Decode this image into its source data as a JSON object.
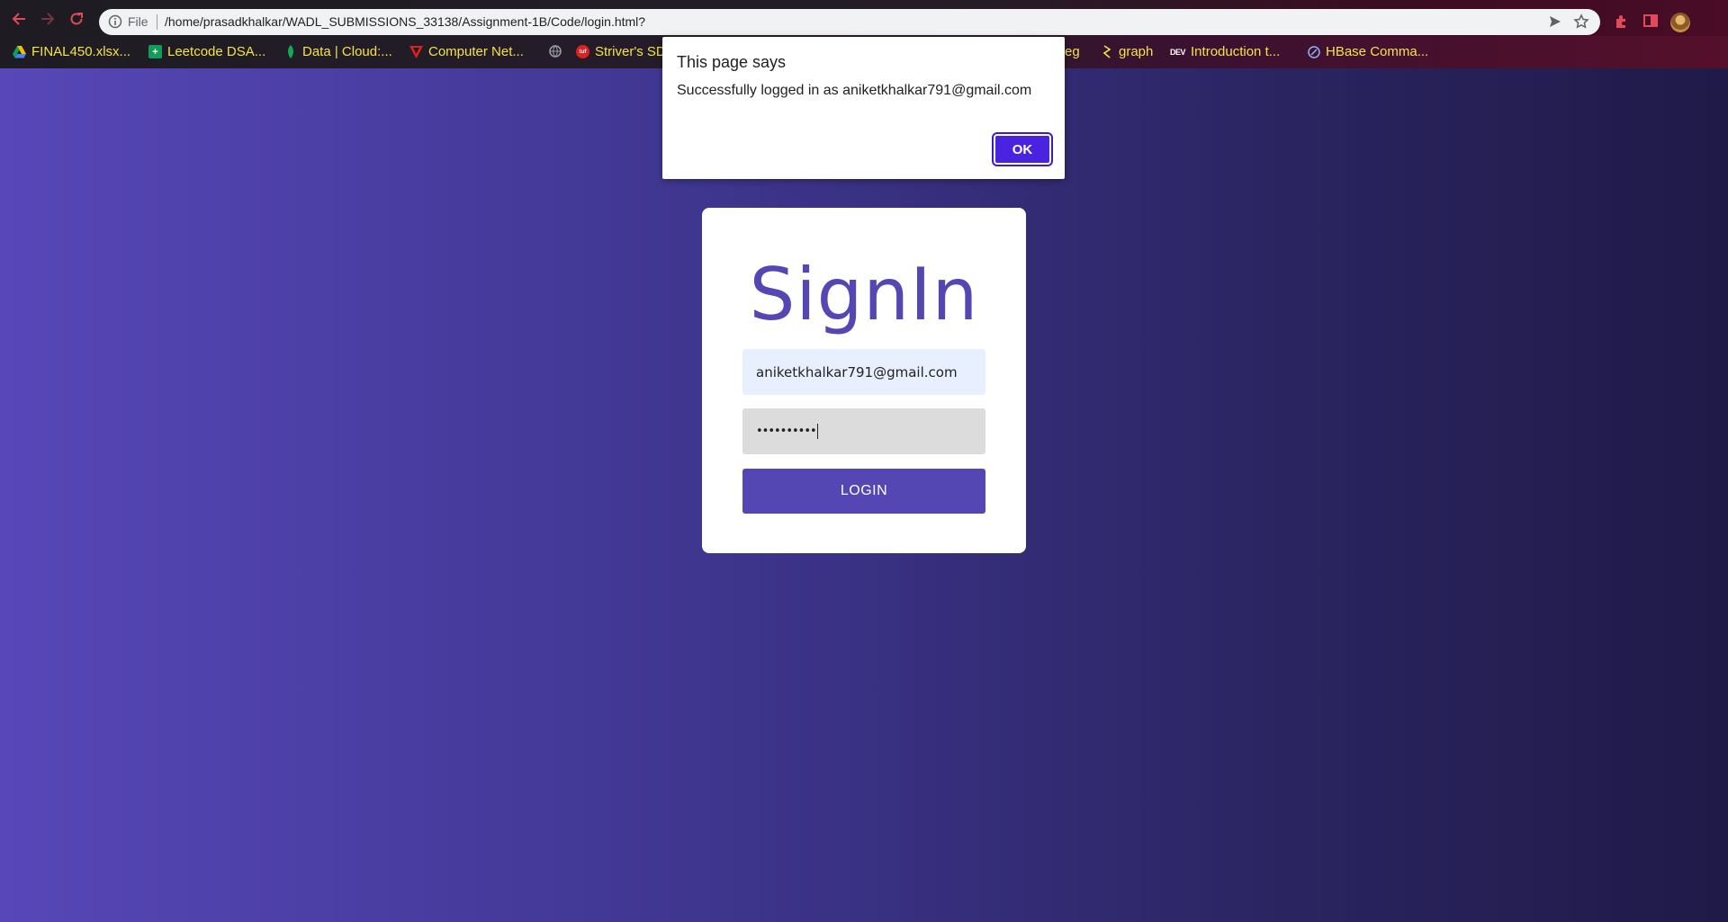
{
  "browser": {
    "url_scheme_label": "File",
    "url": "/home/prasadkhalkar/WADL_SUBMISSIONS_33138/Assignment-1B/Code/login.html?",
    "bookmarks": [
      {
        "label": "FINAL450.xlsx...",
        "icon": "google-drive-icon"
      },
      {
        "label": "Leetcode DSA...",
        "icon": "google-sheets-icon"
      },
      {
        "label": "Data | Cloud:...",
        "icon": "leaf-icon"
      },
      {
        "label": "Computer Net...",
        "icon": "red-triangle-icon"
      },
      {
        "label": "",
        "icon": "globe-icon"
      },
      {
        "label": "Striver's SD",
        "icon": "striver-icon"
      },
      {
        "label": "eg",
        "icon": ""
      },
      {
        "label": "graph",
        "icon": "graph-icon"
      },
      {
        "label": "Introduction t...",
        "icon": "dev-icon"
      },
      {
        "label": "HBase Comma...",
        "icon": "hbase-icon"
      }
    ],
    "dev_icon_text": "DEV"
  },
  "alert": {
    "title": "This page says",
    "message": "Successfully logged in as aniketkhalkar791@gmail.com",
    "ok_label": "OK"
  },
  "login": {
    "title": "SignIn",
    "email_value": "aniketkhalkar791@gmail.com",
    "password_mask": "••••••••••",
    "button_label": "LOGIN"
  },
  "colors": {
    "accent": "#5446b3",
    "alert_button": "#4a23e0",
    "bookmark_text": "#f4e24a"
  }
}
